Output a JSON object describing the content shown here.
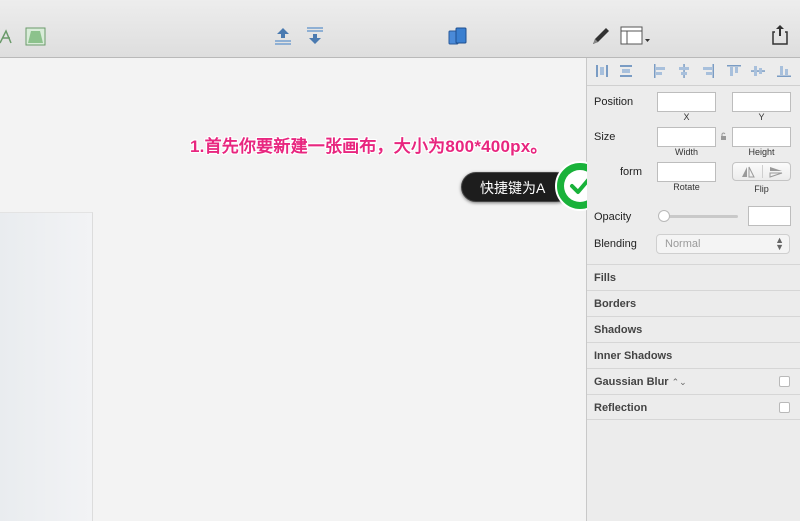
{
  "toolbar": {
    "icons": [
      "vector-icon",
      "mask-icon",
      "forward-icon",
      "backward-icon",
      "mirror-icon",
      "pencil-icon",
      "view-icon",
      "export-icon"
    ]
  },
  "annotation": {
    "instruction": "1.首先你要新建一张画布，大小为800*400px。",
    "tooltip": "快捷键为A"
  },
  "inspector": {
    "position_label": "Position",
    "x_caption": "X",
    "y_caption": "Y",
    "size_label": "Size",
    "width_caption": "Width",
    "height_caption": "Height",
    "transform_label": "Transform",
    "transform_visible": "form",
    "rotate_caption": "Rotate",
    "flip_caption": "Flip",
    "opacity_label": "Opacity",
    "blending_label": "Blending",
    "blending_value": "Normal",
    "sections": {
      "fills": "Fills",
      "borders": "Borders",
      "shadows": "Shadows",
      "inner_shadows": "Inner Shadows",
      "gaussian_blur": "Gaussian Blur",
      "reflection": "Reflection"
    }
  },
  "colors": {
    "annotation": "#e8267f",
    "check_green": "#19b23a",
    "accent_blue": "#3a7fd0"
  }
}
